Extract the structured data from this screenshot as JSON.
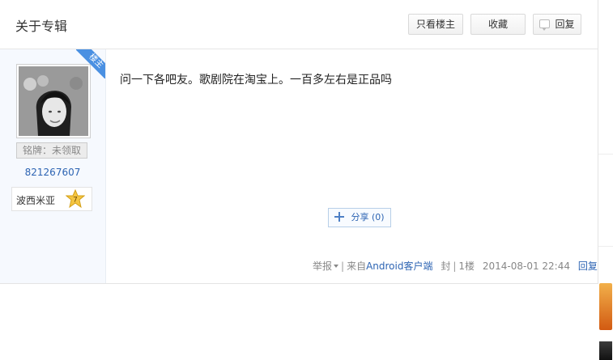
{
  "header": {
    "title": "关于专辑",
    "owner_only": "只看楼主",
    "favorite": "收藏",
    "reply": "回复"
  },
  "author": {
    "badge": "楼主",
    "medal": "铭牌：未领取",
    "uid": "821267607",
    "level_name": "波西米亚",
    "level": "7"
  },
  "post": {
    "content": "问一下各吧友。歌剧院在淘宝上。一百多左右是正品吗",
    "share_label": "分享 (0)"
  },
  "meta": {
    "report": "举报",
    "from_prefix": "来自",
    "client": "Android客户端",
    "seal": "封",
    "floor": "1楼",
    "time": "2014-08-01 22:44",
    "reply": "回复"
  },
  "colors": {
    "link": "#2d64b3",
    "badge": "#4a90e2",
    "sidebar_bg": "#f6f9fe"
  }
}
